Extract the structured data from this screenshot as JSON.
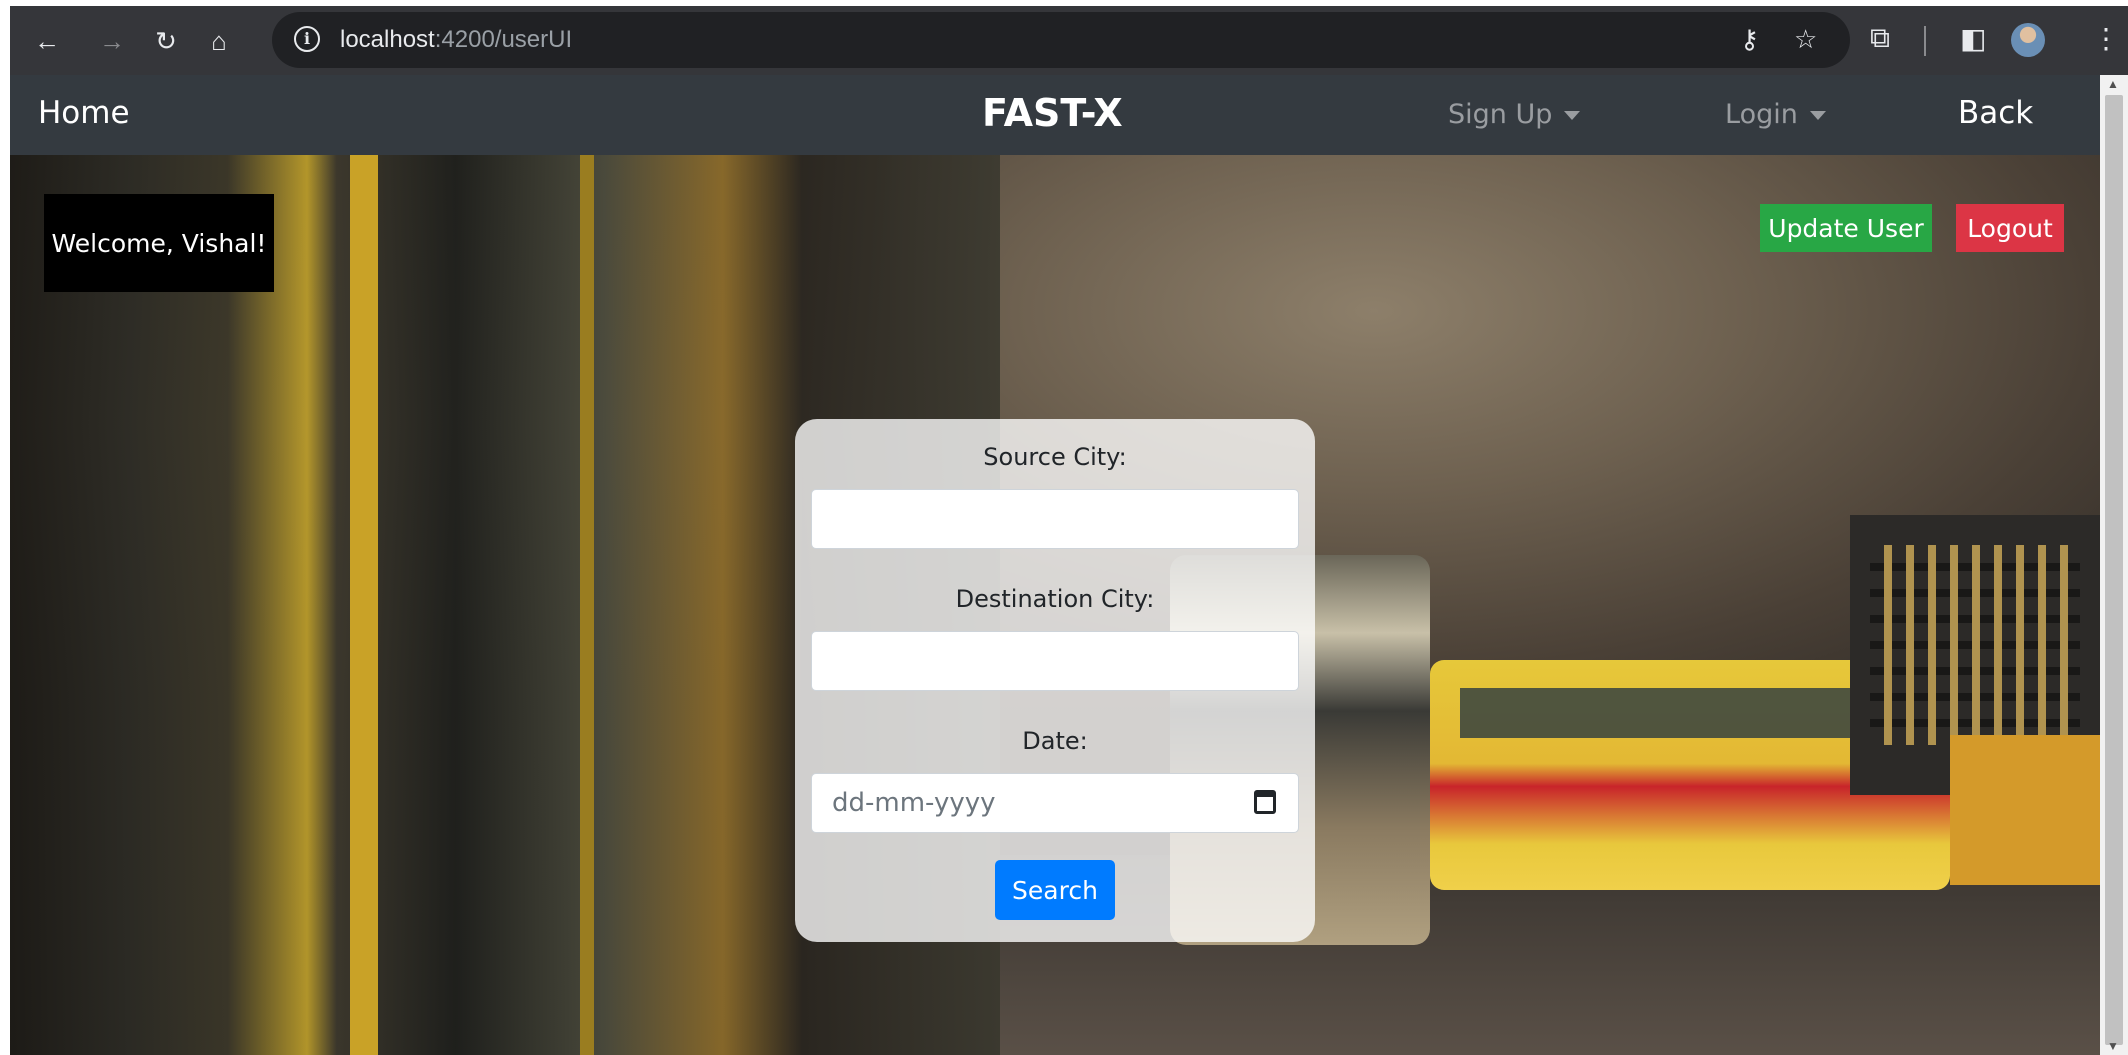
{
  "browser": {
    "url_host": "localhost",
    "url_path": ":4200/userUI",
    "icons": [
      "back-icon",
      "forward-icon",
      "reload-icon",
      "home-icon",
      "site-info-icon",
      "key-icon",
      "star-icon",
      "extensions-icon",
      "side-panel-icon",
      "profile-avatar-icon",
      "menu-icon"
    ]
  },
  "navbar": {
    "home": "Home",
    "brand": "FAST-X",
    "signup": "Sign Up",
    "login": "Login",
    "back": "Back"
  },
  "welcome": "Welcome, Vishal!",
  "actions": {
    "update_user": "Update User",
    "logout": "Logout"
  },
  "search_form": {
    "source_label": "Source City:",
    "source_value": "",
    "destination_label": "Destination City:",
    "destination_value": "",
    "date_label": "Date:",
    "date_placeholder": "dd-mm-yyyy",
    "search_button": "Search"
  },
  "colors": {
    "navbar_bg": "#343a40",
    "update_btn": "#28a745",
    "logout_btn": "#dc3545",
    "search_btn": "#007bff"
  }
}
